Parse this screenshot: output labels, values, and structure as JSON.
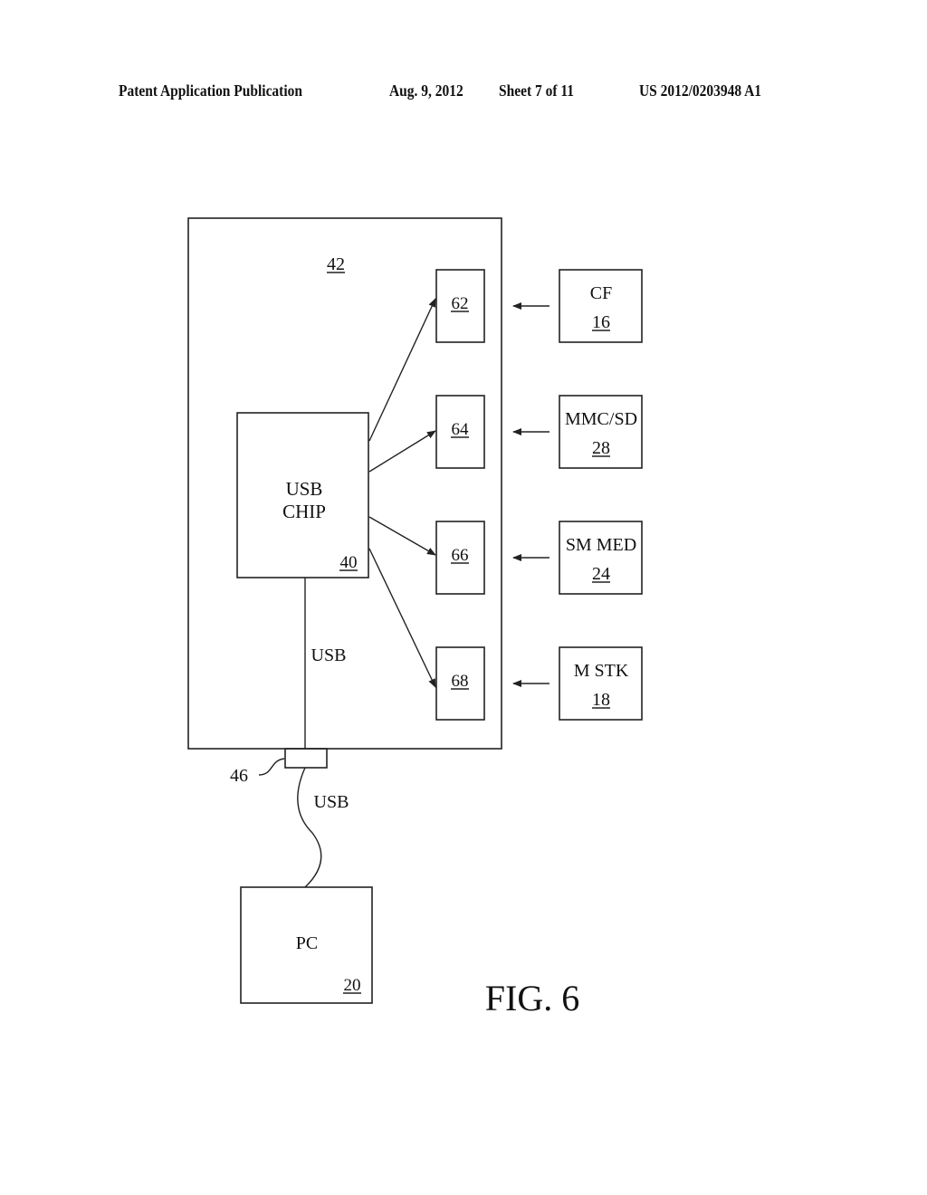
{
  "header": {
    "publication": "Patent Application Publication",
    "date": "Aug. 9, 2012",
    "sheet": "Sheet 7 of 11",
    "number": "US 2012/0203948 A1"
  },
  "figure": {
    "caption": "FIG. 6",
    "reader": {
      "ref": "42"
    },
    "usb_chip": {
      "line1": "USB",
      "line2": "CHIP",
      "ref": "40"
    },
    "slots": [
      {
        "ref": "62"
      },
      {
        "ref": "64"
      },
      {
        "ref": "66"
      },
      {
        "ref": "68"
      }
    ],
    "media": [
      {
        "name": "CF",
        "ref": "16"
      },
      {
        "name": "MMC/SD",
        "ref": "28"
      },
      {
        "name": "SM MED",
        "ref": "24"
      },
      {
        "name": "M STK",
        "ref": "18"
      }
    ],
    "internal_bus_label": "USB",
    "connector": {
      "ref": "46"
    },
    "cable_label": "USB",
    "pc": {
      "name": "PC",
      "ref": "20"
    }
  }
}
